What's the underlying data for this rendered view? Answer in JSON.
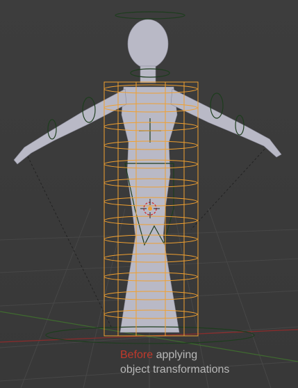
{
  "caption": {
    "highlight": "Before",
    "line1_rest": " applying",
    "line2": "object transformations"
  },
  "colors": {
    "background": "#3a3a3a",
    "grid": "#454545",
    "x_axis": "#8c2b2b",
    "y_axis": "#3f6b2f",
    "mesh_fill": "#b9b9c6",
    "rig_wire": "#1d3d1d",
    "cage_selected": "#f0a030",
    "caption_text": "#b8b8b8",
    "caption_highlight": "#c0392b"
  },
  "icons": [
    "3d-cursor-icon",
    "object-origin-icon"
  ]
}
